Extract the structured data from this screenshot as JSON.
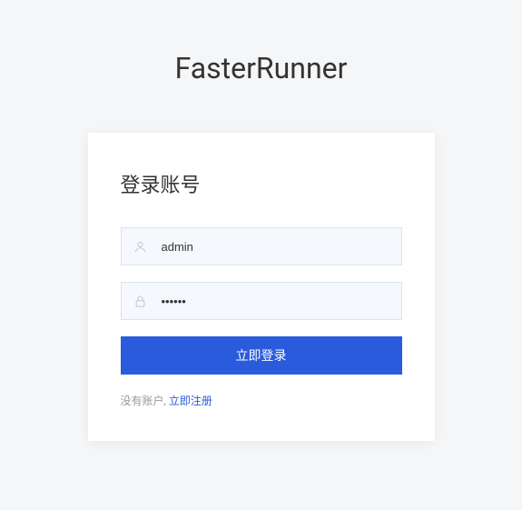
{
  "app": {
    "title": "FasterRunner"
  },
  "login": {
    "card_title": "登录账号",
    "username_value": "admin",
    "password_value": "••••••",
    "submit_label": "立即登录",
    "no_account_text": "没有账户, ",
    "register_link_text": "立即注册"
  },
  "colors": {
    "primary": "#2a5bdc",
    "background": "#f5f6f7"
  }
}
